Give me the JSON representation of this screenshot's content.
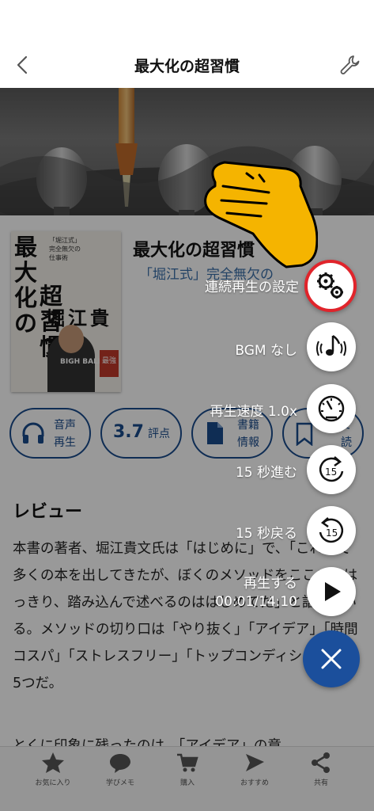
{
  "header": {
    "title": "最大化の超習慣"
  },
  "book": {
    "title": "最大化の超習慣",
    "subtitle": "「堀江式」完全無欠の",
    "cover": {
      "tag": "「堀江式」完全無欠の仕事術",
      "title_line1": "最大化の",
      "title_line2": "超習慣",
      "author": "堀江貴文",
      "badge": "最強",
      "shirt": "BIGH BALL"
    }
  },
  "actions": {
    "audio": {
      "line1": "音声",
      "line2": "再生"
    },
    "rating": {
      "value": "3.7",
      "label": "評点"
    },
    "info": {
      "line1": "書籍",
      "line2": "情報"
    },
    "read": {
      "line1": "で",
      "line2": "読む"
    }
  },
  "review": {
    "heading": "レビュー",
    "body": "本書の著者、堀江貴文氏は「はじめに」で、「これまで多くの本を出してきたが、ぼくのメソッドをここまではっきり、踏み込んで述べるのははじめてだ」と語っている。メソッドの切り口は「やり抜く」「アイデア」「時間コスパ」「ストレスフリー」「トップコンディション」の5つだ。",
    "next_line": "とくに印象に残ったのは、「アイデア」の章"
  },
  "tabbar": {
    "items": [
      {
        "label": "お気に入り",
        "icon": "star-icon"
      },
      {
        "label": "学びメモ",
        "icon": "chat-bubble-icon"
      },
      {
        "label": "購入",
        "icon": "cart-icon"
      },
      {
        "label": "おすすめ",
        "icon": "send-arrow-icon"
      },
      {
        "label": "共有",
        "icon": "share-icon"
      }
    ]
  },
  "fab_menu": {
    "continuous": "連続再生の設定",
    "bgm": "BGM なし",
    "speed": "再生速度 1.0x",
    "forward": "15 秒進む",
    "rewind": "15 秒戻る",
    "play": "再生する",
    "time": "00:01/14:10",
    "skip_seconds": "15"
  },
  "colors": {
    "accent": "#1b4f9c",
    "highlight_ring": "#e0242b",
    "hand": "#f5b400"
  }
}
